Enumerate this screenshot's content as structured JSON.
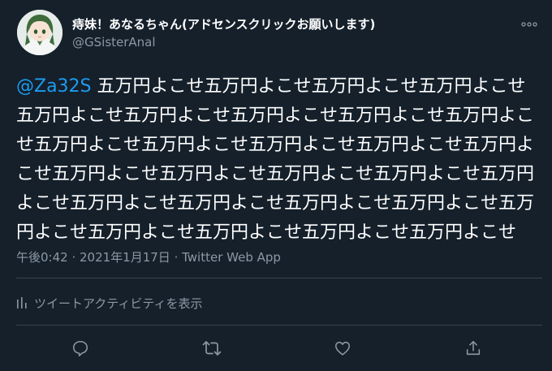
{
  "author": {
    "display_name": "痔妹！あなるちゃん(アドセンスクリックお願いします)",
    "handle": "@GSisterAnal"
  },
  "tweet": {
    "mention": "@Za32S",
    "text": " 五万円よこせ五万円よこせ五万円よこせ五万円よこせ五万円よこせ五万円よこせ五万円よこせ五万円よこせ五万円よこせ五万円よこせ五万円よこせ五万円よこせ五万円よこせ五万円よこせ五万円よこせ五万円よこせ五万円よこせ五万円よこせ五万円よこせ五万円よこせ五万円よこせ五万円よこせ五万円よこせ五万円よこせ五万円よこせ五万円よこせ五万円よこせ五万円よこせ",
    "timestamp": "午後0:42 · 2021年1月17日",
    "separator": " · ",
    "source": "Twitter Web App"
  },
  "activity_link": "ツイートアクティビティを表示",
  "icons": {
    "more": "more-dots-icon",
    "reply": "reply-icon",
    "retweet": "retweet-icon",
    "like": "heart-icon",
    "share": "share-icon",
    "activity": "analytics-bars-icon"
  },
  "colors": {
    "background": "#15202b",
    "text": "#ffffff",
    "secondary": "#8b98a5",
    "link": "#1d9bf0",
    "divider": "#38444d"
  }
}
